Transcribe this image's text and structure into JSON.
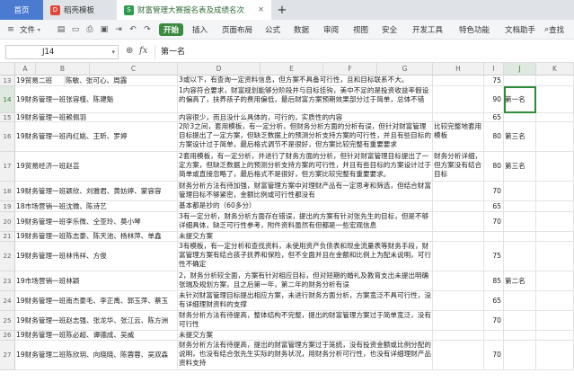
{
  "tabs": {
    "home": "首页",
    "template": "稻壳模板",
    "document": "财富管理大赛报名表及成绩名次",
    "close": "×",
    "add": "+"
  },
  "menu": {
    "file": "文件",
    "start": "开始",
    "insert": "插入",
    "page_layout": "页面布局",
    "formula": "公式",
    "data": "数据",
    "review": "审阅",
    "view": "视图",
    "security": "安全",
    "developer": "开发工具",
    "special": "特色功能",
    "doc_assist": "文档助手",
    "search": "查找"
  },
  "formula_bar": {
    "cell_ref": "J14",
    "fx": "fx",
    "value": "第一名"
  },
  "columns": [
    "A",
    "B",
    "C",
    "D",
    "E",
    "F",
    "G",
    "H",
    "I",
    "J",
    "K"
  ],
  "active_column": "J",
  "rows": [
    {
      "num": "13",
      "team": "19贸易二班",
      "members": "陈敏、张可心、周露",
      "comment": "3或以下，有查询一定资料信息，但方案不具备可行性，且和目标联系不大。",
      "h": "",
      "score": "75",
      "rank": ""
    },
    {
      "num": "14",
      "team": "19财务管理一班张容槿、陈建魁",
      "members": "",
      "comment": "1内容符合要求，财富规划能够分阶段并与目标挂钩，美中不足的是投资收益率假设的偏高了，扶养孩子的费用偏低，最后财富方案预期效果部分过于简单，总体不错",
      "h": "",
      "score": "90",
      "rank": "第一名"
    },
    {
      "num": "15",
      "team": "19财务管理一班赖佩羽",
      "members": "",
      "comment": "内容很少，而且没什么具体的，可行的，实质性的内容",
      "h": "",
      "score": "65",
      "rank": ""
    },
    {
      "num": "16",
      "team": "19财务管理一班冉红姚、王昕、罗婷",
      "members": "",
      "comment": "2阶3之间，套用模板，有一定分析，但财务分析方面的分析有误，但针对财富管理目标提出了一定方案，但缺乏数据上的预测分析支持方案的可行性，并且有些目标的方案设计过于简单，最后格式调节不是很好，但方案比较完整有重要要求",
      "h": "比较完整地套用模板",
      "score": "80",
      "rank": "第三名"
    },
    {
      "num": "17",
      "team": "19贸易经济一班赵芸",
      "members": "",
      "comment": "2套用模板，有一定分析，并进行了财务方面的分析，但针对财富管理目标提出了一定方案，但缺乏数据上的预测分析支持方案的可行性，并且有些目标的方案设计过于简单或直接忽略了，最后格式不是很好，但方案比较完整有重要要求。",
      "h": "财务分析详细，但方案没有结合目标",
      "score": "80",
      "rank": "第三名"
    },
    {
      "num": "18",
      "team": "19财务管理一班颖欣、刘雅君、黄妨婷、蒙容容",
      "members": "",
      "comment": "财务分析方法有待加强，财富管理方案中对理财产品有一定思考和筛选，但结合财富管理目标不够紧密，金额比例或可行性都没有",
      "h": "",
      "score": "70",
      "rank": ""
    },
    {
      "num": "19",
      "team": "18市场营销一班沈微、陈诗艺",
      "members": "",
      "comment": "基本都是抄的（60多分）",
      "h": "",
      "score": "65",
      "rank": ""
    },
    {
      "num": "20",
      "team": "19财务管理一班李乐微、仝亚玲、莫小琴",
      "members": "",
      "comment": "3有一定分析，财务分析方面存在错误，提出的方案有针对张先生的目标，但是不够详细具体，缺乏可行性参考，附件资料虽然有但都是一些宏观信息",
      "h": "",
      "score": "70",
      "rank": ""
    },
    {
      "num": "21",
      "team": "19财务管理一班陈志豪、陈天池、杨林萍、单鑫",
      "members": "",
      "comment": "未提交方案",
      "h": "",
      "score": "",
      "rank": ""
    },
    {
      "num": "22",
      "team": "19财务管理一班林伟祥、方俊",
      "members": "",
      "comment": "3有模板，有一定分析和查找资料，未使用资产负债表和现金流量表等财务手段，财富管理方案有结合孩子抚养和保险，但不全面并且在金额和比例上为配未说明，可行性不确定",
      "h": "",
      "score": "75",
      "rank": ""
    },
    {
      "num": "23",
      "team": "19市场营销一班林颖",
      "members": "",
      "comment": "2，财务分析较全面，方案有针对相应目标，但对短期的婚礼及教育支出未提出明确张瑞及规划方案，且之后第一年，第二年的财务分析有误",
      "h": "",
      "score": "85",
      "rank": "第二名"
    },
    {
      "num": "24",
      "team": "19财务管理一班南杰豪毛、李正禹、郭玉萍、蔡玉",
      "members": "",
      "comment": "未针对财富管理目标提出相应方案，未进行财务方面分析，方案宽泛不具可行性，没有详细理财资料的支撑",
      "h": "",
      "score": "65",
      "rank": ""
    },
    {
      "num": "25",
      "team": "19财务管理一班赵志强、张龙华、张江云、陈方洲",
      "members": "",
      "comment": "财务分析方法有待提高，整体结构不完整，提出的财富管理方案过于简单宽泛，没有可行性",
      "h": "",
      "score": "70",
      "rank": ""
    },
    {
      "num": "26",
      "team": "19财务管理一班陈必超、谭德成、吴威",
      "members": "",
      "comment": "未提交方案",
      "h": "",
      "score": "",
      "rank": ""
    },
    {
      "num": "27",
      "team": "19财务管理二班陈欣玥、向晓晓、陈蓉蓉、吴双森",
      "members": "",
      "comment": "财务分析方法有待提高，提出的财富管理方案过于笼统，没有投资金额或比例分配的说明，也没有结合张先生实际的财务状况，用财务分析可行性，也没有详细理财产品资料支持",
      "h": "",
      "score": "70",
      "rank": ""
    }
  ]
}
